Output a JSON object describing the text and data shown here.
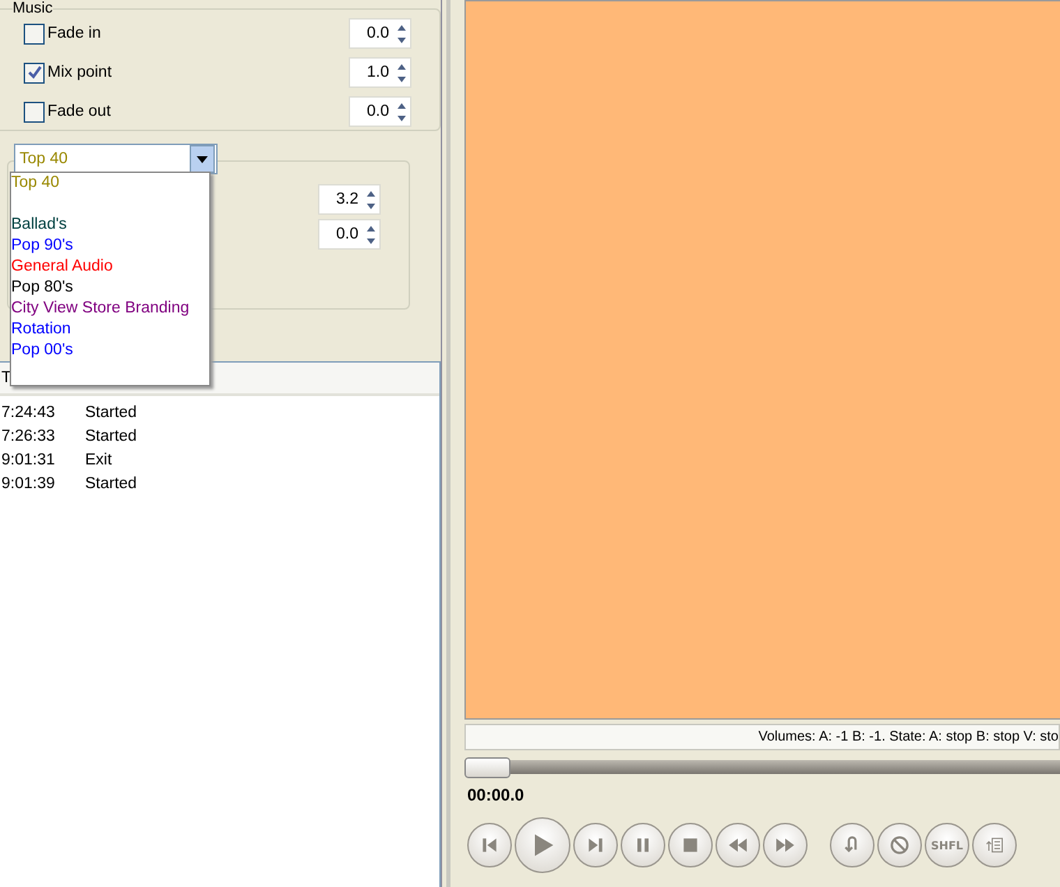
{
  "music_group": {
    "title": "Music",
    "rows": [
      {
        "label": "Fade in",
        "checked": false,
        "value": "0.0"
      },
      {
        "label": "Mix point",
        "checked": true,
        "value": "1.0"
      },
      {
        "label": "Fade out",
        "checked": false,
        "value": "0.0"
      }
    ]
  },
  "category_group": {
    "combo": {
      "value": "Top 40",
      "color": "#998800",
      "expanded": true
    },
    "spinners": [
      "3.2",
      "0.0"
    ],
    "dropdown_items": [
      {
        "label": "Top 40",
        "color": "#998800",
        "gap_after": true
      },
      {
        "label": "Ballad's",
        "color": "#004040",
        "gap_after": false
      },
      {
        "label": "Pop 90's",
        "color": "#0000ff",
        "gap_after": false
      },
      {
        "label": "General Audio",
        "color": "#ff0000",
        "gap_after": false
      },
      {
        "label": "Pop 80's",
        "color": "#000000",
        "gap_after": false
      },
      {
        "label": "City View Store Branding",
        "color": "#800080",
        "gap_after": false
      },
      {
        "label": "Rotation",
        "color": "#0000ff",
        "gap_after": false
      },
      {
        "label": "Pop 00's",
        "color": "#0000ff",
        "gap_after": false
      }
    ]
  },
  "log": {
    "columns": [
      "T"
    ],
    "rows": [
      {
        "time": "7:24:43",
        "event": "Started"
      },
      {
        "time": "7:26:33",
        "event": "Started"
      },
      {
        "time": "9:01:31",
        "event": "Exit"
      },
      {
        "time": "9:01:39",
        "event": "Started"
      }
    ]
  },
  "player": {
    "status": "Volumes: A: -1 B: -1. State: A: stop B: stop V: sto",
    "position": {
      "level": 0
    },
    "time": "00:00.0",
    "transport": [
      {
        "kind": "previous"
      },
      {
        "kind": "play"
      },
      {
        "kind": "next"
      },
      {
        "kind": "pause"
      },
      {
        "kind": "stop"
      },
      {
        "kind": "rewind"
      },
      {
        "kind": "forward"
      }
    ],
    "extras": [
      {
        "kind": "repeat"
      },
      {
        "kind": "block"
      },
      {
        "kind": "shuffle",
        "label": "SHFL"
      },
      {
        "kind": "playlist"
      }
    ]
  }
}
